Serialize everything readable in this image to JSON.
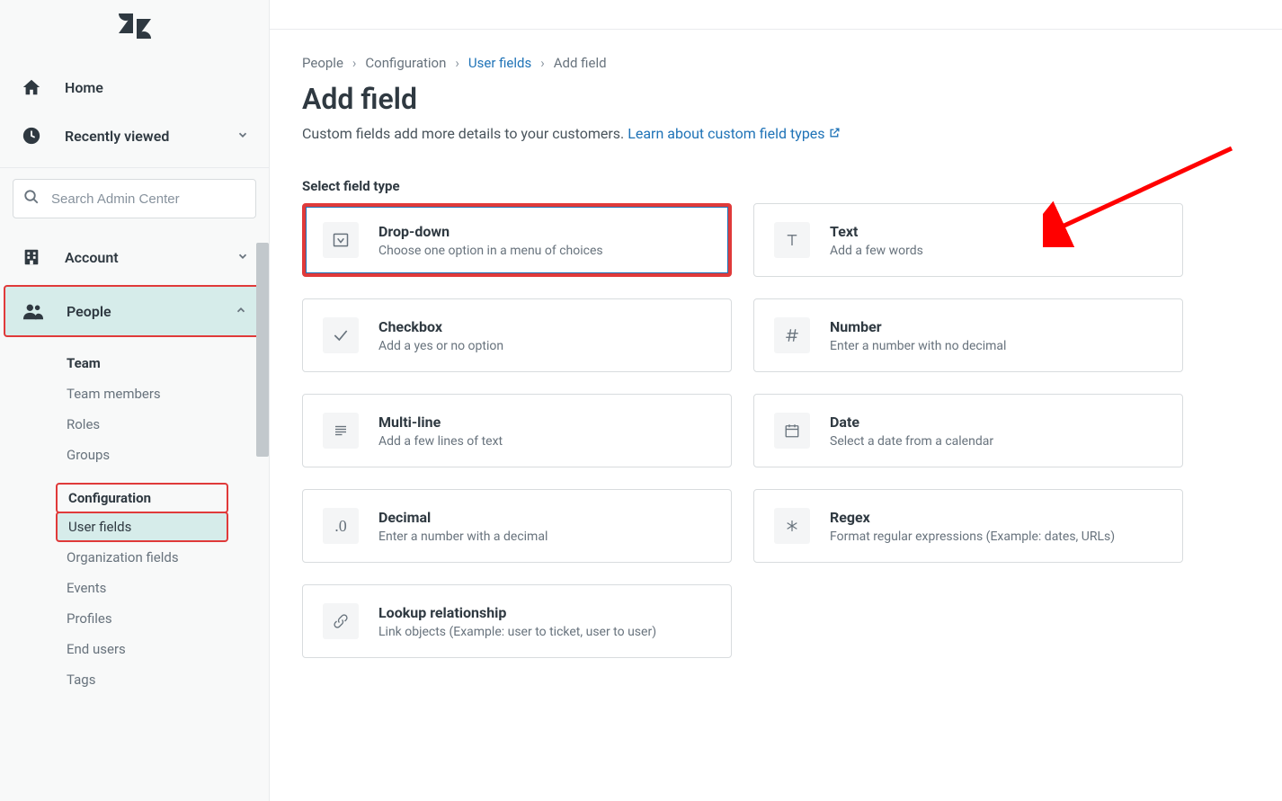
{
  "sidebar": {
    "home": "Home",
    "recently_viewed": "Recently viewed",
    "search_placeholder": "Search Admin Center",
    "account": "Account",
    "people": "People",
    "team": {
      "heading": "Team",
      "members": "Team members",
      "roles": "Roles",
      "groups": "Groups"
    },
    "config": {
      "heading": "Configuration",
      "user_fields": "User fields",
      "org_fields": "Organization fields",
      "events": "Events",
      "profiles": "Profiles",
      "end_users": "End users",
      "tags": "Tags"
    }
  },
  "breadcrumb": {
    "people": "People",
    "configuration": "Configuration",
    "user_fields": "User fields",
    "add_field": "Add field"
  },
  "page": {
    "title": "Add field",
    "desc_text": "Custom fields add more details to your customers. ",
    "learn_link": "Learn about custom field types"
  },
  "section_label": "Select field type",
  "fields": {
    "dropdown": {
      "title": "Drop-down",
      "desc": "Choose one option in a menu of choices"
    },
    "text": {
      "title": "Text",
      "desc": "Add a few words"
    },
    "checkbox": {
      "title": "Checkbox",
      "desc": "Add a yes or no option"
    },
    "number": {
      "title": "Number",
      "desc": "Enter a number with no decimal"
    },
    "multiline": {
      "title": "Multi-line",
      "desc": "Add a few lines of text"
    },
    "date": {
      "title": "Date",
      "desc": "Select a date from a calendar"
    },
    "decimal": {
      "title": "Decimal",
      "desc": "Enter a number with a decimal"
    },
    "regex": {
      "title": "Regex",
      "desc": "Format regular expressions (Example: dates, URLs)"
    },
    "lookup": {
      "title": "Lookup relationship",
      "desc": "Link objects (Example: user to ticket, user to user)"
    }
  }
}
